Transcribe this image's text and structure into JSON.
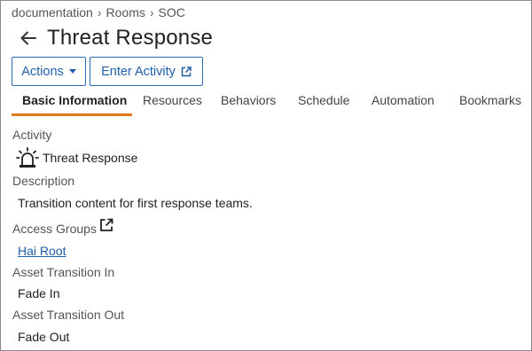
{
  "breadcrumb": {
    "items": [
      "documentation",
      "Rooms",
      "SOC"
    ],
    "separator": "›"
  },
  "header": {
    "title": "Threat Response"
  },
  "toolbar": {
    "actions_label": "Actions",
    "enter_activity_label": "Enter Activity"
  },
  "tabs": [
    {
      "label": "Basic Information",
      "active": true
    },
    {
      "label": "Resources"
    },
    {
      "label": "Behaviors"
    },
    {
      "label": "Schedule"
    },
    {
      "label": "Automation"
    },
    {
      "label": "Bookmarks"
    }
  ],
  "fields": {
    "activity": {
      "label": "Activity",
      "value": "Threat Response",
      "icon": "siren-icon"
    },
    "description": {
      "label": "Description",
      "value": "Transition content for first response teams."
    },
    "access_groups": {
      "label": "Access Groups",
      "value": "Hai Root",
      "icon": "external-link-icon"
    },
    "asset_transition_in": {
      "label": "Asset Transition In",
      "value": "Fade In"
    },
    "asset_transition_out": {
      "label": "Asset Transition Out",
      "value": "Fade Out"
    }
  },
  "colors": {
    "accent": "#1e5fa8",
    "tab_underline": "#e07a1f",
    "border": "#8a8a8a"
  }
}
